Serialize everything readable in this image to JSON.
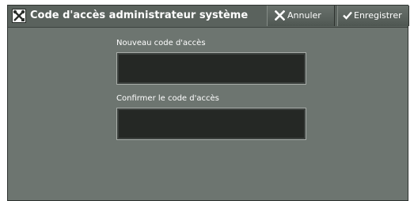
{
  "window": {
    "title": "Code d'accès administrateur système",
    "title_icon": "tools-icon"
  },
  "toolbar": {
    "cancel_label": "Annuler",
    "cancel_icon": "close-icon",
    "save_label": "Enregistrer",
    "save_icon": "checkmark-icon"
  },
  "form": {
    "new_code_label": "Nouveau code d'accès",
    "new_code_value": "",
    "confirm_code_label": "Confirmer le code d'accès",
    "confirm_code_value": ""
  },
  "colors": {
    "panel_background": "#6d7570",
    "title_bar": "#5a625d",
    "input_background": "#252825",
    "text": "#ffffff"
  }
}
